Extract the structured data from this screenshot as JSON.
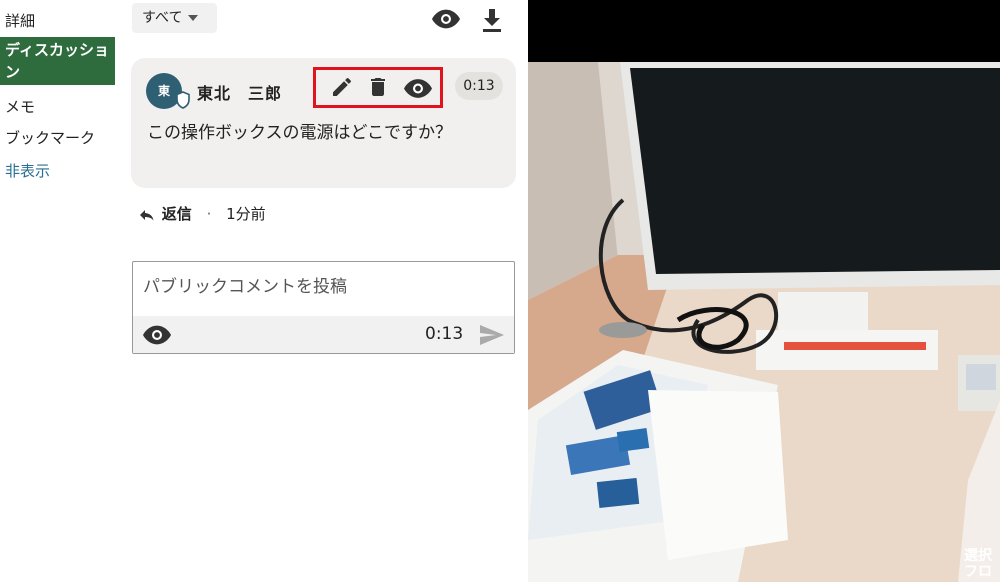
{
  "sidebar": {
    "items": [
      {
        "label": "詳細"
      },
      {
        "label": "ディスカッション"
      },
      {
        "label": "メモ"
      },
      {
        "label": "ブックマーク"
      },
      {
        "label": "非表示"
      }
    ]
  },
  "toolbar": {
    "filter_label": "すべて",
    "visibility_icon": "eye-icon",
    "download_icon": "download-icon"
  },
  "comment": {
    "avatar_text": "東",
    "author": "東北　三郎",
    "timestamp": "0:13",
    "text": "この操作ボックスの電源はどこですか？",
    "reply_label": "返信",
    "separator": "·",
    "age": "1分前"
  },
  "composer": {
    "placeholder": "パブリックコメントを投稿",
    "timestamp": "0:13"
  },
  "video": {
    "caption_line1": "選択",
    "caption_line2": "フロ"
  },
  "colors": {
    "accent_green": "#2e6b3d",
    "link_blue": "#2a6f93",
    "highlight_red": "#e0141e",
    "avatar_bg": "#2e5f72"
  }
}
